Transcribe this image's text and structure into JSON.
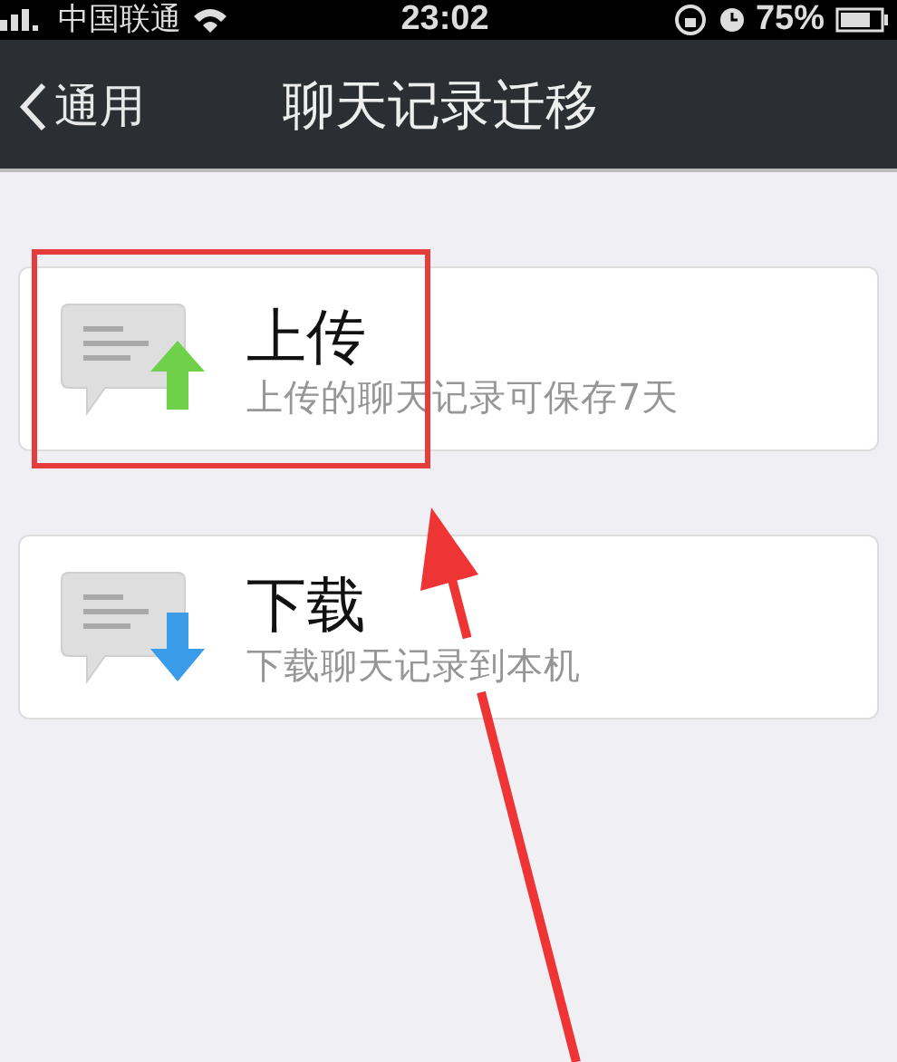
{
  "status_bar": {
    "carrier": "中国联通",
    "time": "23:02",
    "battery": "75%"
  },
  "nav_bar": {
    "back_label": "通用",
    "title": "聊天记录迁移"
  },
  "options": [
    {
      "kind": "upload",
      "title": "上传",
      "subtitle": "上传的聊天记录可保存7天"
    },
    {
      "kind": "download",
      "title": "下载",
      "subtitle": "下载聊天记录到本机"
    }
  ],
  "highlight_box": true,
  "pointer_arrow": true
}
